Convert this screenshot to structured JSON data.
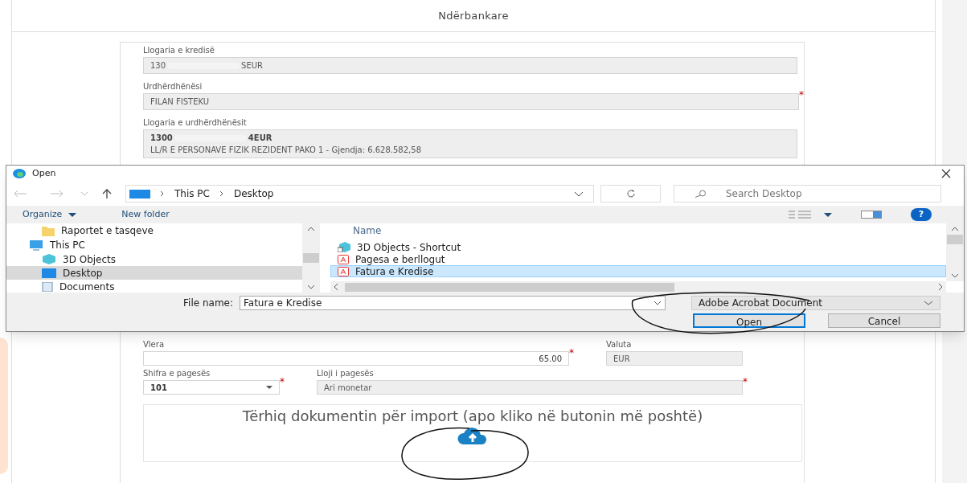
{
  "page": {
    "title": "Ndërbankare"
  },
  "fields_top": [
    {
      "label": "Llogaria e kredisë",
      "kind": "redacted",
      "prefix": "130",
      "suffix": "SEUR",
      "disabled": true
    },
    {
      "label": "Urdhërdhënësi",
      "kind": "text",
      "value": "FILAN FISTEKU",
      "disabled": true,
      "required_mark": "*"
    },
    {
      "label": "Llogaria e urdhërdhënësit",
      "kind": "account",
      "prefix": "1300",
      "suffix": "4EUR",
      "detail": "LL/R E PERSONAVE FIZIK REZIDENT PAKO 1 - Gjendja: 6.628.582,58",
      "disabled": true
    }
  ],
  "amount": {
    "label": "Vlera",
    "value": "65.00",
    "disabled": false,
    "required_mark": "*"
  },
  "currency": {
    "label": "Valuta",
    "value": "EUR",
    "disabled": true
  },
  "payment_code": {
    "label": "Shifra e pagesës",
    "value": "101",
    "disabled": false,
    "required_mark": "*"
  },
  "payment_type": {
    "label": "Lloji i pagesës",
    "value": "Ari monetar",
    "disabled": true,
    "required_mark": "*"
  },
  "dropzone": {
    "text": "Tërhiq dokumentin për import (apo kliko në butonin më poshtë)"
  },
  "dialog": {
    "title": "Open",
    "path": [
      "This PC",
      "Desktop"
    ],
    "search_placeholder": "Search Desktop",
    "toolbar": [
      "Organize",
      "New folder"
    ],
    "help_label": "?",
    "nav_items": [
      {
        "label": "Raportet e tasqeve",
        "kind": "folder",
        "selected": false
      },
      {
        "label": "This PC",
        "kind": "pc",
        "selected": false,
        "children": [
          {
            "label": "3D Objects",
            "kind": "cube",
            "selected": false
          },
          {
            "label": "Desktop",
            "kind": "desktop",
            "selected": true
          },
          {
            "label": "Documents",
            "kind": "documents",
            "selected": false
          }
        ]
      }
    ],
    "column": "Name",
    "files": [
      {
        "name": "3D Objects - Shortcut",
        "kind": "shortcut",
        "selected": false
      },
      {
        "name": "Pagesa e berllogut",
        "kind": "pdf",
        "selected": false
      },
      {
        "name": "Fatura e Kredise",
        "kind": "pdf",
        "selected": true
      }
    ],
    "file_name_label": "File name:",
    "file_name": "Fatura e Kredise",
    "file_type": "Adobe Acrobat Document",
    "buttons": [
      {
        "label": "Open",
        "default": true
      },
      {
        "label": "Cancel",
        "default": false
      }
    ]
  }
}
